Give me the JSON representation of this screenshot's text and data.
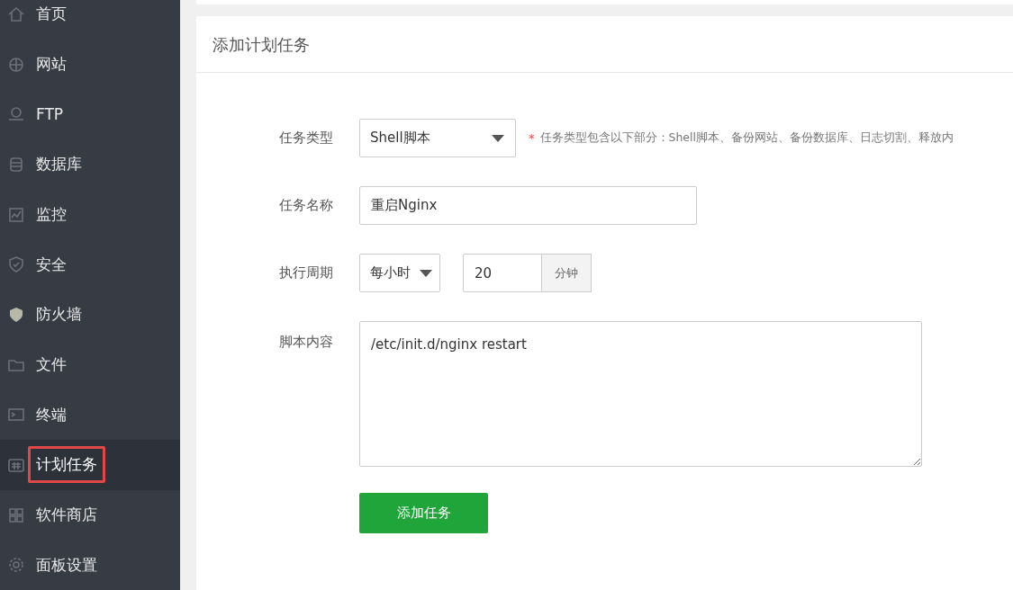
{
  "sidebar": {
    "items": [
      {
        "label": "首页",
        "selected": false,
        "highlighted": false
      },
      {
        "label": "网站",
        "selected": false,
        "highlighted": false
      },
      {
        "label": "FTP",
        "selected": false,
        "highlighted": false
      },
      {
        "label": "数据库",
        "selected": false,
        "highlighted": false
      },
      {
        "label": "监控",
        "selected": false,
        "highlighted": false
      },
      {
        "label": "安全",
        "selected": false,
        "highlighted": false
      },
      {
        "label": "防火墙",
        "selected": false,
        "highlighted": false
      },
      {
        "label": "文件",
        "selected": false,
        "highlighted": false
      },
      {
        "label": "终端",
        "selected": false,
        "highlighted": false
      },
      {
        "label": "计划任务",
        "selected": true,
        "highlighted": true
      },
      {
        "label": "软件商店",
        "selected": false,
        "highlighted": false
      },
      {
        "label": "面板设置",
        "selected": false,
        "highlighted": false
      }
    ]
  },
  "card": {
    "title": "添加计划任务",
    "form": {
      "task_type": {
        "label": "任务类型",
        "value": "Shell脚本",
        "hint_mark": "*",
        "hint": "任务类型包含以下部分：Shell脚本、备份网站、备份数据库、日志切割、释放内"
      },
      "task_name": {
        "label": "任务名称",
        "value": "重启Nginx"
      },
      "period": {
        "label": "执行周期",
        "value": "每小时",
        "minutes": "20",
        "unit": "分钟"
      },
      "script": {
        "label": "脚本内容",
        "value": "/etc/init.d/nginx restart"
      },
      "submit": "添加任务"
    }
  }
}
